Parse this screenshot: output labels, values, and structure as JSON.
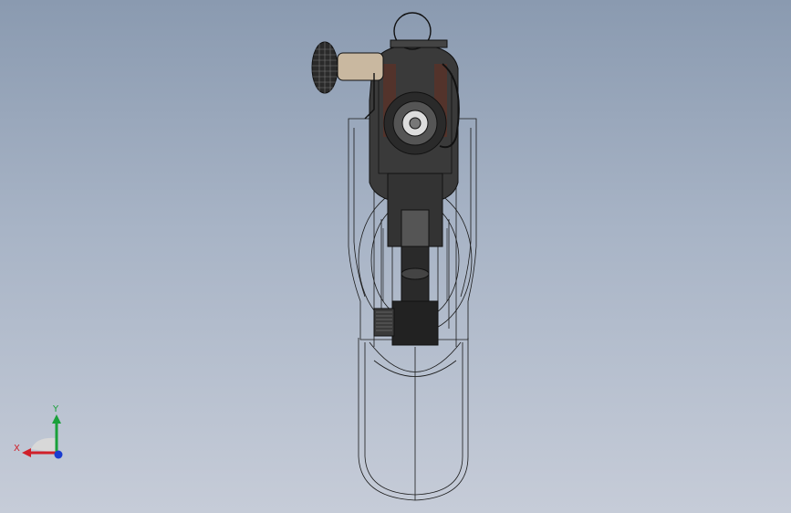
{
  "viewport": {
    "background_top": "#8a9ab0",
    "background_bottom": "#c6ccd8"
  },
  "model": {
    "body_color": "#3a3a3a",
    "wire_color": "#1a1a1a",
    "knob_color": "#c9b8a0"
  },
  "triad": {
    "x_label": "X",
    "y_label": "Y",
    "x_color": "#d0202a",
    "y_color": "#1aa03a",
    "z_color": "#1a3cd0"
  }
}
